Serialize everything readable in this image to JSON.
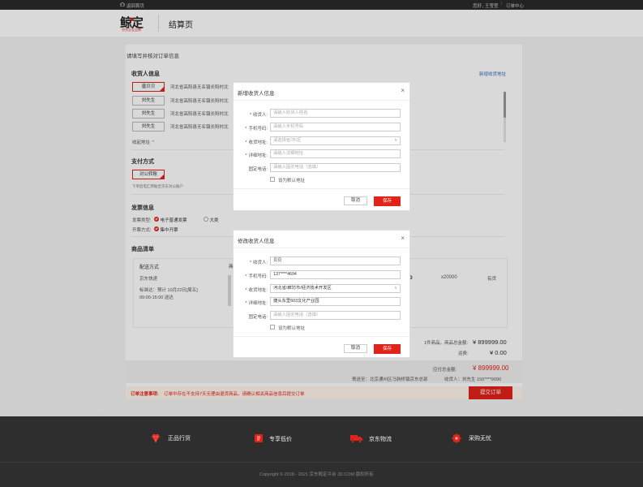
{
  "topbar": {
    "home_link": "返回首页",
    "greeting": "您好，",
    "username": "王莹莹",
    "order_center": "订单中心"
  },
  "header": {
    "logo_main": "鲸定",
    "logo_sub": "京东企业品牌",
    "page_title": "结算页"
  },
  "main": {
    "heading": "请填写并核对订单信息",
    "consignee": {
      "title": "收货人信息",
      "add_link": "新增收货地址",
      "addresses": [
        {
          "name": "唐贝贝",
          "address": "河北省高阳县无名镇长阳村北"
        },
        {
          "name": "刘先生",
          "address": "河北省高阳县无名镇长阳村北"
        },
        {
          "name": "刘先生",
          "address": "河北省高阳县无名镇长阳村北"
        },
        {
          "name": "刘先生",
          "address": "河北省高阳县无名镇长阳村北"
        }
      ],
      "collapse": "收起地址"
    },
    "payment": {
      "title": "支付方式",
      "method": "对公转账",
      "note": "下单后电汇转账至京东对公账户"
    },
    "invoice": {
      "title": "发票信息",
      "type_label": "发票类型:",
      "type_selected": "电子普通发票",
      "type_other": "大类",
      "mode_label": "开票方式:",
      "mode_value": "集中开票"
    },
    "goods": {
      "title": "商品清单",
      "delivery_title": "配送方式",
      "delivery_method": "京东快递",
      "delivery_time_1": "标准达：预计 10月22日[周五]",
      "delivery_time_2": "09:00-15:00 送达",
      "col_short": "商",
      "price_tail": "0",
      "quantity": "x20000",
      "stock": "有货"
    }
  },
  "summary": {
    "goods_count_label": "1件商品，商品总金额:",
    "goods_amount": "¥ 899999.00",
    "freight_label": "运费:",
    "freight_amount": "¥ 0.00",
    "payable_label": "应付总金额:",
    "payable_amount": "¥ 899999.00",
    "ship_to": "寄送至：北京通州区马驹桥镇京东总部",
    "receiver": "收货人：刘先生 150****9090",
    "notice_label": "订单注意事项:",
    "notice_text": "订单中存在不支持7天无理由退货商品，请确认相关商品信息后提交订单",
    "submit": "提交订单"
  },
  "modal_add": {
    "title": "新增收货人信息",
    "fields": [
      {
        "label": "收货人:",
        "required": true,
        "placeholder": "请输入收货人姓名",
        "value": ""
      },
      {
        "label": "手机号码:",
        "required": true,
        "placeholder": "请输入手机号码",
        "value": ""
      },
      {
        "label": "收货地址:",
        "required": true,
        "placeholder": "请选择省/市/区",
        "value": ""
      },
      {
        "label": "详细地址:",
        "required": true,
        "placeholder": "请输入详细地址",
        "value": ""
      },
      {
        "label": "固定电话:",
        "required": false,
        "placeholder": "请输入固定电话（选填）",
        "value": ""
      }
    ],
    "default_label": "设为默认地址",
    "cancel": "取消",
    "save": "保存"
  },
  "modal_edit": {
    "title": "修改收货人信息",
    "fields": [
      {
        "label": "收货人:",
        "required": true,
        "placeholder": "",
        "value": "贝贝"
      },
      {
        "label": "手机号码:",
        "required": true,
        "placeholder": "",
        "value": "137****4694"
      },
      {
        "label": "收货地址:",
        "required": true,
        "placeholder": "",
        "value": "河北省/廊坊市/经济技术开发区"
      },
      {
        "label": "详细地址:",
        "required": true,
        "placeholder": "",
        "value": "捷头东里603文化产业园"
      },
      {
        "label": "固定电话:",
        "required": false,
        "placeholder": "请输入固定电话（选填）",
        "value": ""
      }
    ],
    "default_label": "设为默认地址",
    "cancel": "取消",
    "save": "保存"
  },
  "footer": {
    "features": [
      {
        "icon": "diamond-icon",
        "label": "正品行货"
      },
      {
        "icon": "price-tag-icon",
        "label": "专享低价"
      },
      {
        "icon": "truck-icon",
        "label": "京东物流"
      },
      {
        "icon": "service-badge-icon",
        "label": "采购无忧"
      }
    ],
    "copyright": "Copyright © 2018 - 2021 京东鲸定平台 JD.COM 版权所有"
  },
  "colors": {
    "accent": "#e2231a",
    "link": "#2d6cc6",
    "footer_bg": "#2e2e2e",
    "topbar_bg": "#2a2a2a"
  }
}
